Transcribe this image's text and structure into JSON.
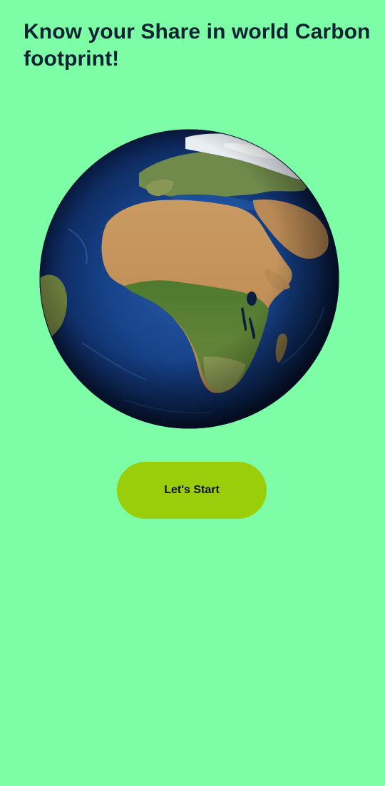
{
  "header": {
    "title": "Know your Share in world Carbon footprint!"
  },
  "hero": {
    "image": "earth-globe-africa-view"
  },
  "actions": {
    "start_label": "Let's Start"
  },
  "theme": {
    "background": "#7dfea6",
    "button_color": "#9acd0a",
    "title_color": "#0d2233"
  }
}
